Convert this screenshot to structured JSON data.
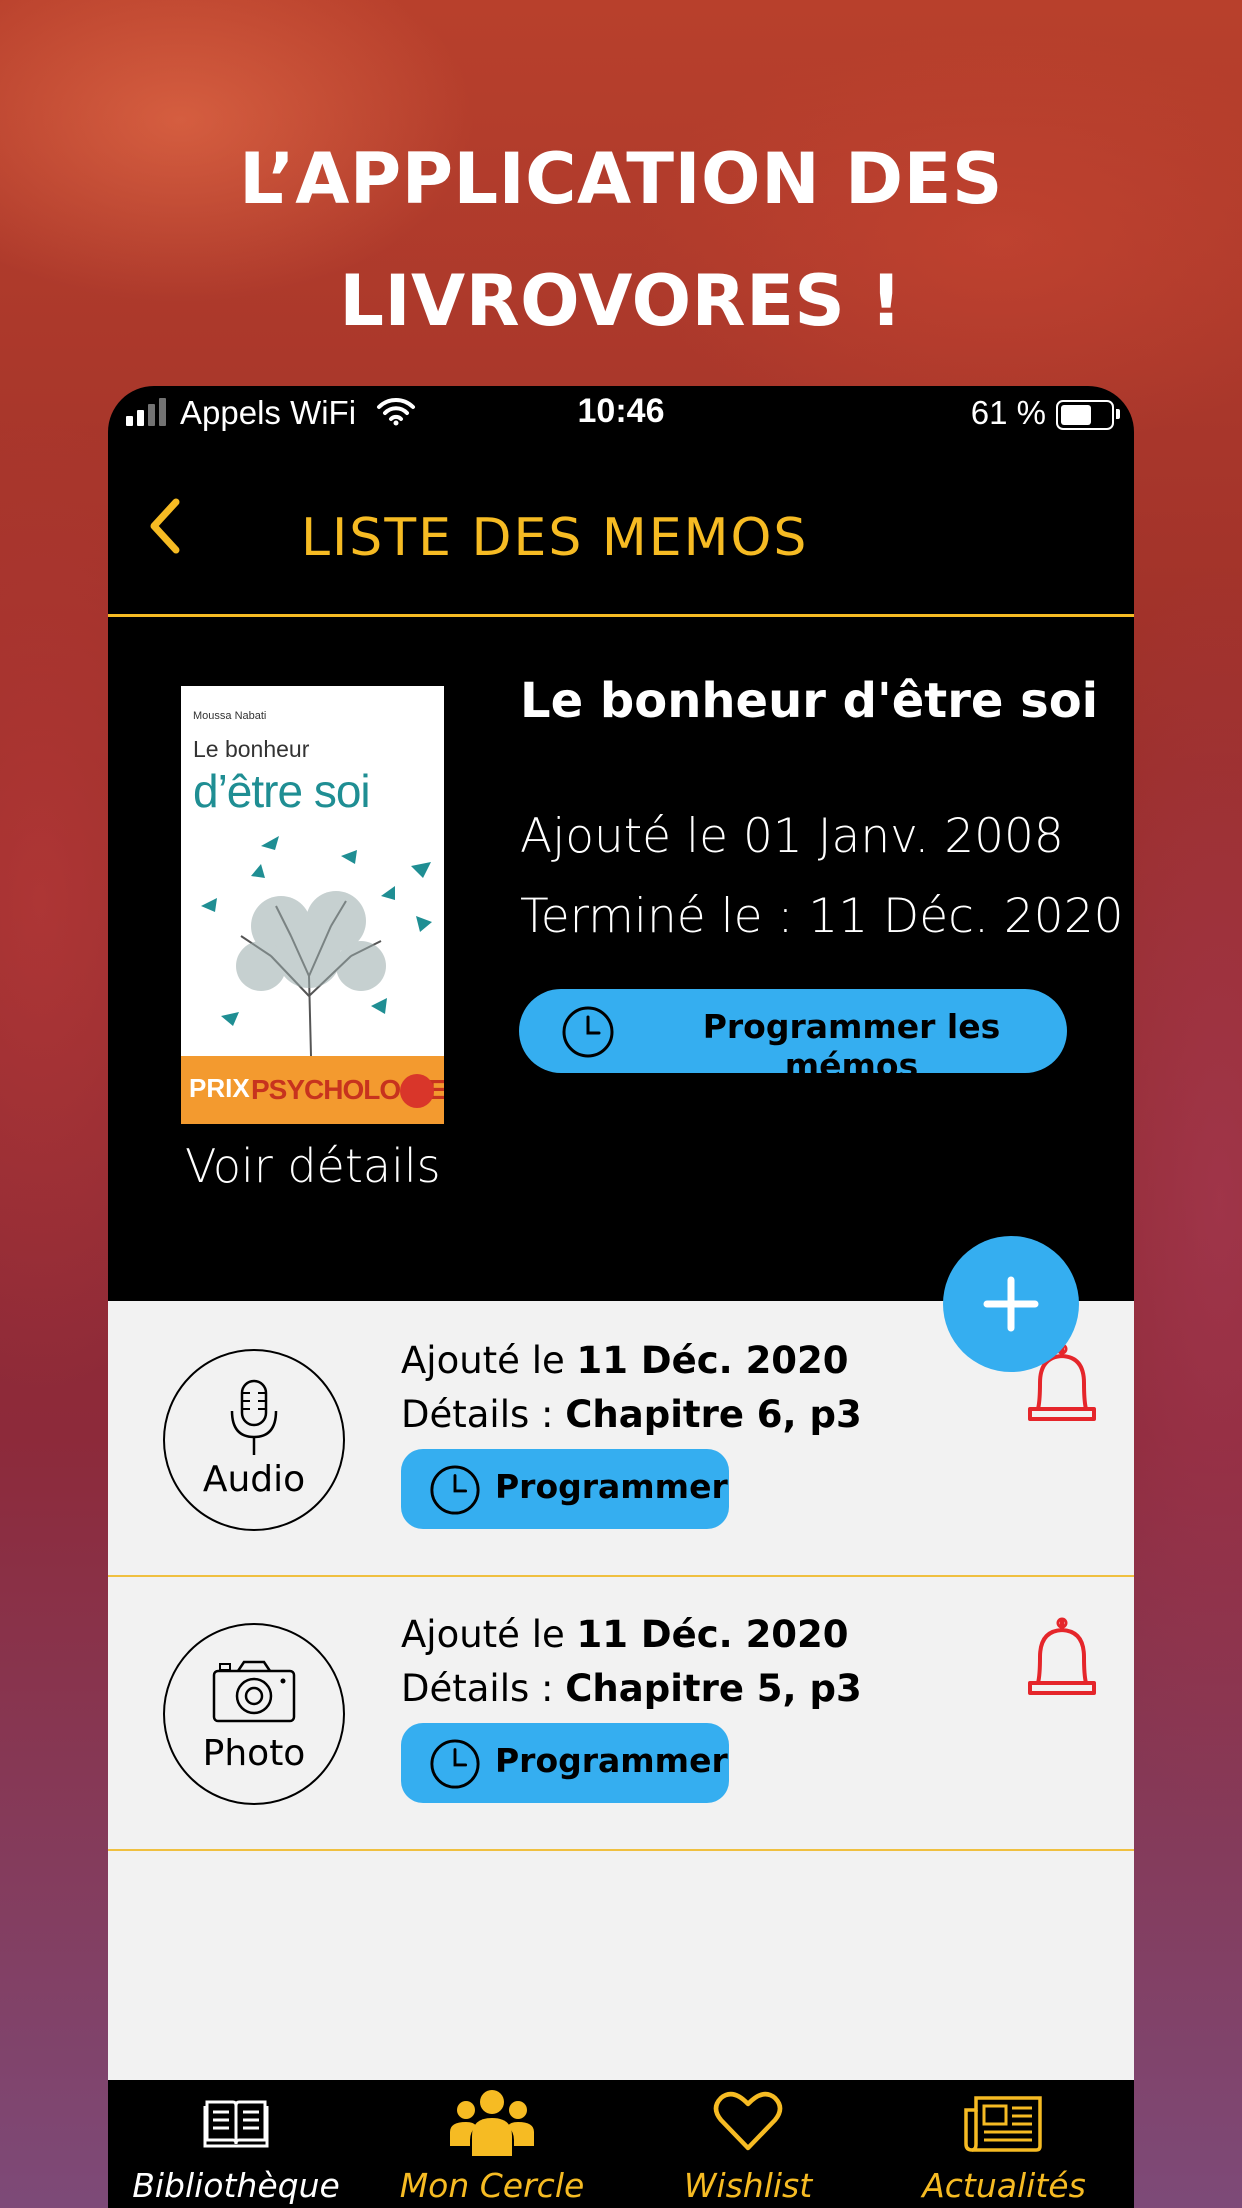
{
  "headline": {
    "line1": "L’APPLICATION DES",
    "line2": "LIVROVORES !"
  },
  "status_bar": {
    "carrier": "Appels WiFi",
    "time": "10:46",
    "battery": "61 %"
  },
  "nav": {
    "title": "LISTE DES MEMOS",
    "back_icon": "chevron-left-icon"
  },
  "book": {
    "title": "Le bonheur d'être soi",
    "added": "Ajouté le 01 Janv. 2008",
    "finished": "Terminé le : 11 Déc. 2020",
    "schedule_button": "Programmer les mémos",
    "details_link": "Voir détails",
    "cover": {
      "author": "Moussa Nabati",
      "title_line1": "Le bonheur",
      "title_line2": "d’être soi",
      "prix": "PRIX",
      "psychologies": "PSYCHOLOGIES"
    }
  },
  "memos": [
    {
      "type_label": "Audio",
      "icon": "microphone-icon",
      "added_prefix": "Ajouté le ",
      "added_date": "11 Déc. 2020",
      "details_prefix": "Détails : ",
      "details_value": "Chapitre 6, p3",
      "button": "Programmer"
    },
    {
      "type_label": "Photo",
      "icon": "camera-icon",
      "added_prefix": "Ajouté le ",
      "added_date": "11 Déc. 2020",
      "details_prefix": "Détails : ",
      "details_value": "Chapitre 5, p3",
      "button": "Programmer"
    }
  ],
  "tabs": [
    {
      "label": "Bibliothèque",
      "icon": "book-icon",
      "color": "#ffffff"
    },
    {
      "label": "Mon Cercle",
      "icon": "group-icon",
      "color": "#f6bb23"
    },
    {
      "label": "Wishlist",
      "icon": "heart-icon",
      "color": "#f6bb23"
    },
    {
      "label": "Actualités",
      "icon": "newspaper-icon",
      "color": "#f6bb23"
    }
  ],
  "colors": {
    "accent": "#f6bb23",
    "button_blue": "#35aef0",
    "bell_red": "#e5262b"
  }
}
